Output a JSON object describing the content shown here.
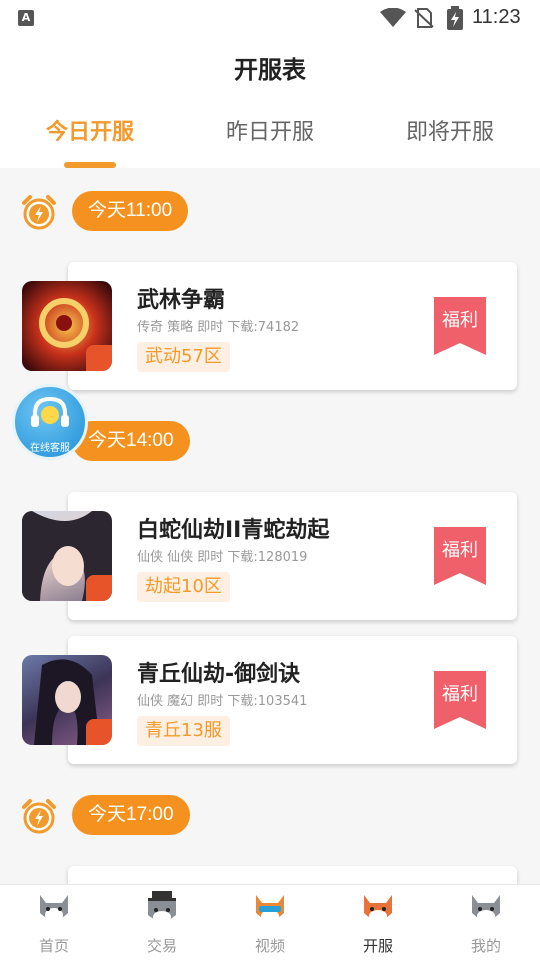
{
  "status_bar": {
    "time": "11:23",
    "notification_icon": "A"
  },
  "header": {
    "title": "开服表",
    "tabs": [
      {
        "label": "今日开服",
        "active": true
      },
      {
        "label": "昨日开服",
        "active": false
      },
      {
        "label": "即将开服",
        "active": false
      }
    ]
  },
  "schedule": [
    {
      "time": "今天11:00",
      "games": [
        {
          "name": "武林争霸",
          "meta": "传奇 策略 即时 下载:74182",
          "server": "武动57区",
          "bonus": "福利",
          "icon": "warrior-dragon-icon"
        }
      ]
    },
    {
      "time": "今天14:00",
      "games": [
        {
          "name": "白蛇仙劫II青蛇劫起",
          "meta": "仙侠 仙侠 即时 下载:128019",
          "server": "劫起10区",
          "bonus": "福利",
          "icon": "white-snake-girl-icon"
        },
        {
          "name": "青丘仙劫-御剑诀",
          "meta": "仙侠 魔幻 即时 下载:103541",
          "server": "青丘13服",
          "bonus": "福利",
          "icon": "qingqiu-girl-icon"
        }
      ]
    },
    {
      "time": "今天17:00",
      "games": []
    }
  ],
  "customer_service": {
    "label": "在线客服"
  },
  "bottom_nav": [
    {
      "label": "首页",
      "icon": "wolf-home-icon",
      "active": false
    },
    {
      "label": "交易",
      "icon": "wolf-trade-icon",
      "active": false
    },
    {
      "label": "视频",
      "icon": "fox-video-icon",
      "active": false
    },
    {
      "label": "开服",
      "icon": "fox-server-icon",
      "active": true
    },
    {
      "label": "我的",
      "icon": "wolf-profile-icon",
      "active": false
    }
  ],
  "colors": {
    "accent": "#f39a2c",
    "pill": "#f5921f",
    "bonus": "#f0606a"
  }
}
